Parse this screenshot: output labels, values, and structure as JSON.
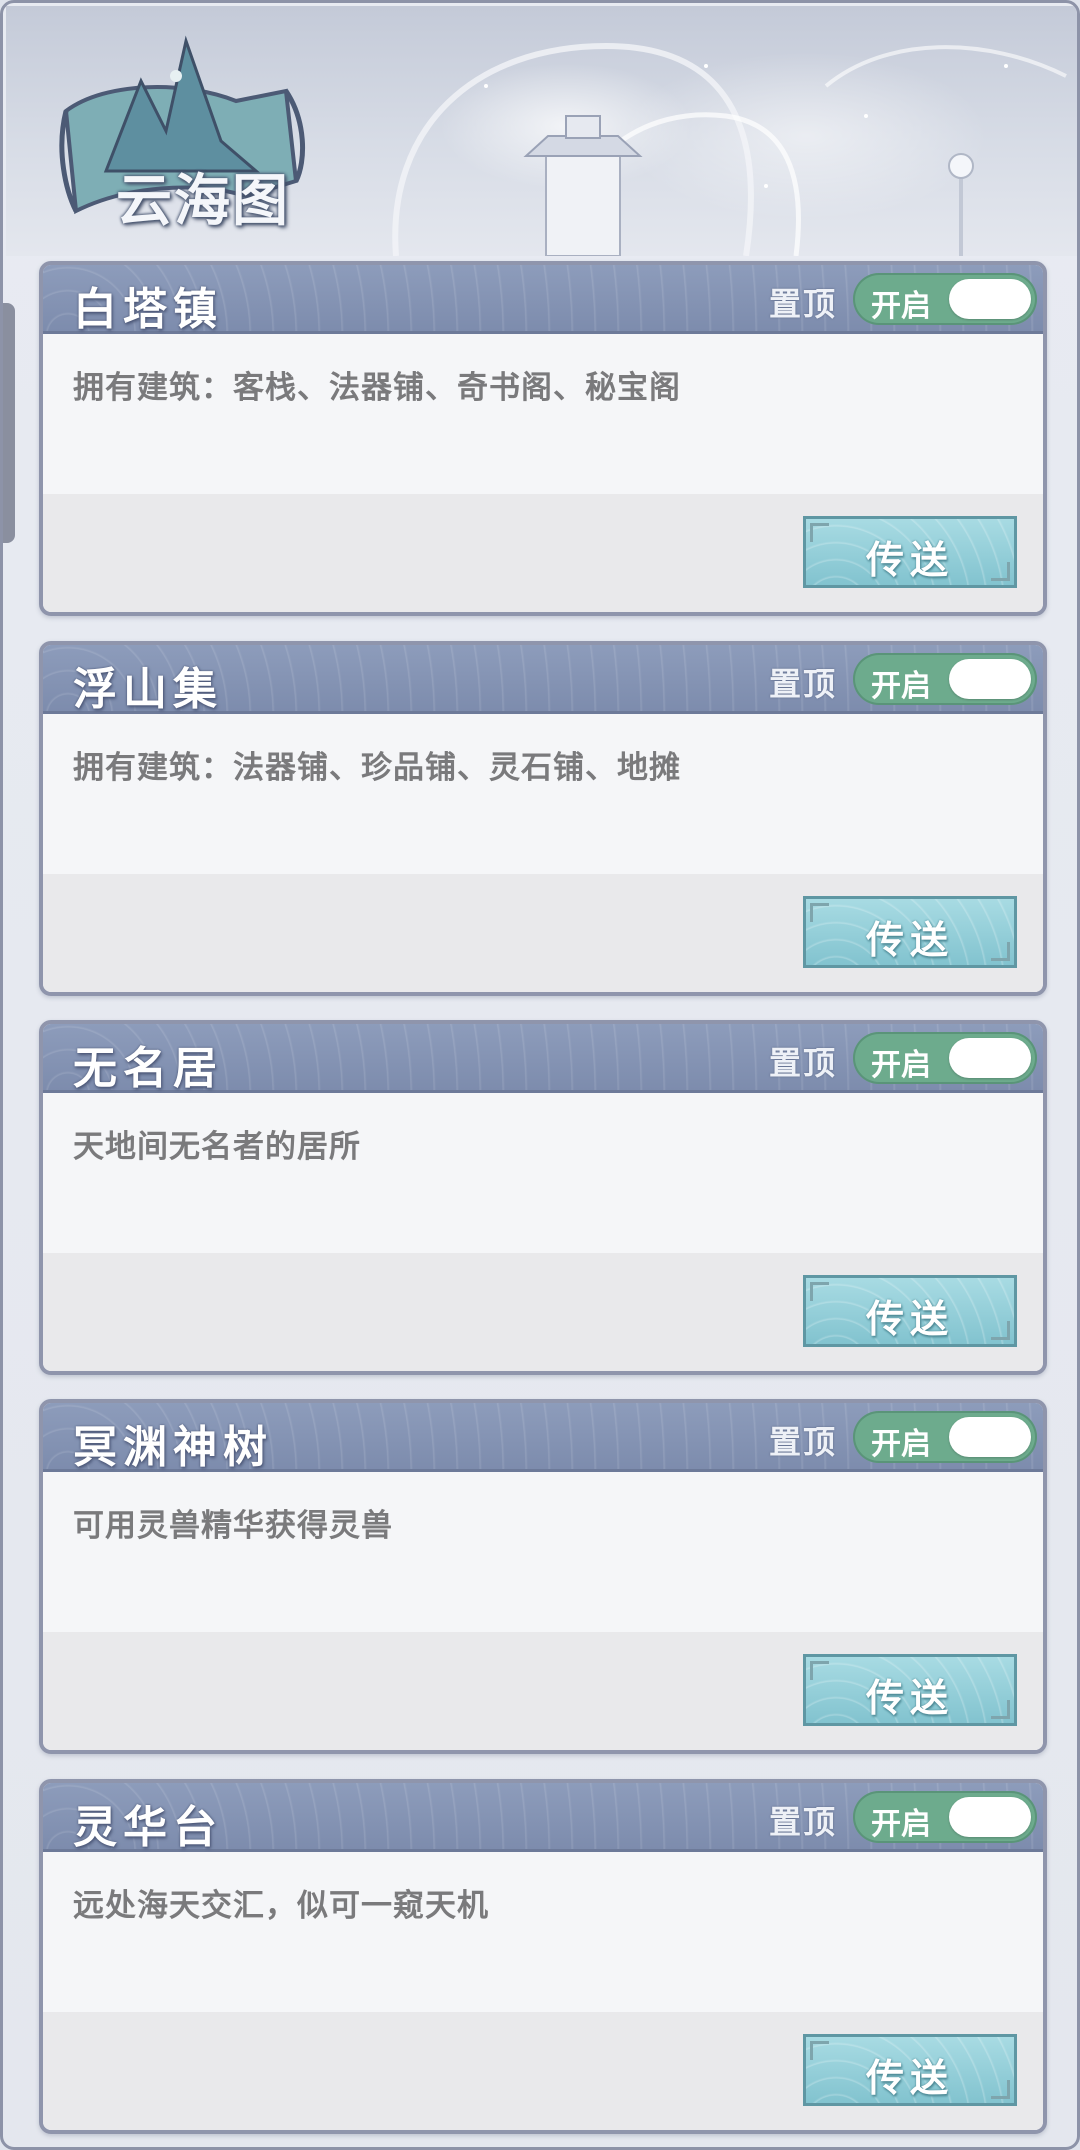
{
  "header": {
    "title": "云海图"
  },
  "labels": {
    "pin": "置顶",
    "toggle_on": "开启",
    "teleport": "传送"
  },
  "colors": {
    "card_header": "#7d8cad",
    "toggle_on": "#6dab8d",
    "teleport_button": "#82c3cf",
    "description_text": "#7a7a7c"
  },
  "locations": [
    {
      "name": "白塔镇",
      "description": "拥有建筑：客栈、法器铺、奇书阁、秘宝阁",
      "toggle_on": true
    },
    {
      "name": "浮山集",
      "description": "拥有建筑：法器铺、珍品铺、灵石铺、地摊",
      "toggle_on": true
    },
    {
      "name": "无名居",
      "description": "天地间无名者的居所",
      "toggle_on": true
    },
    {
      "name": "冥渊神树",
      "description": "可用灵兽精华获得灵兽",
      "toggle_on": true
    },
    {
      "name": "灵华台",
      "description": "远处海天交汇，似可一窥天机",
      "toggle_on": true
    }
  ]
}
